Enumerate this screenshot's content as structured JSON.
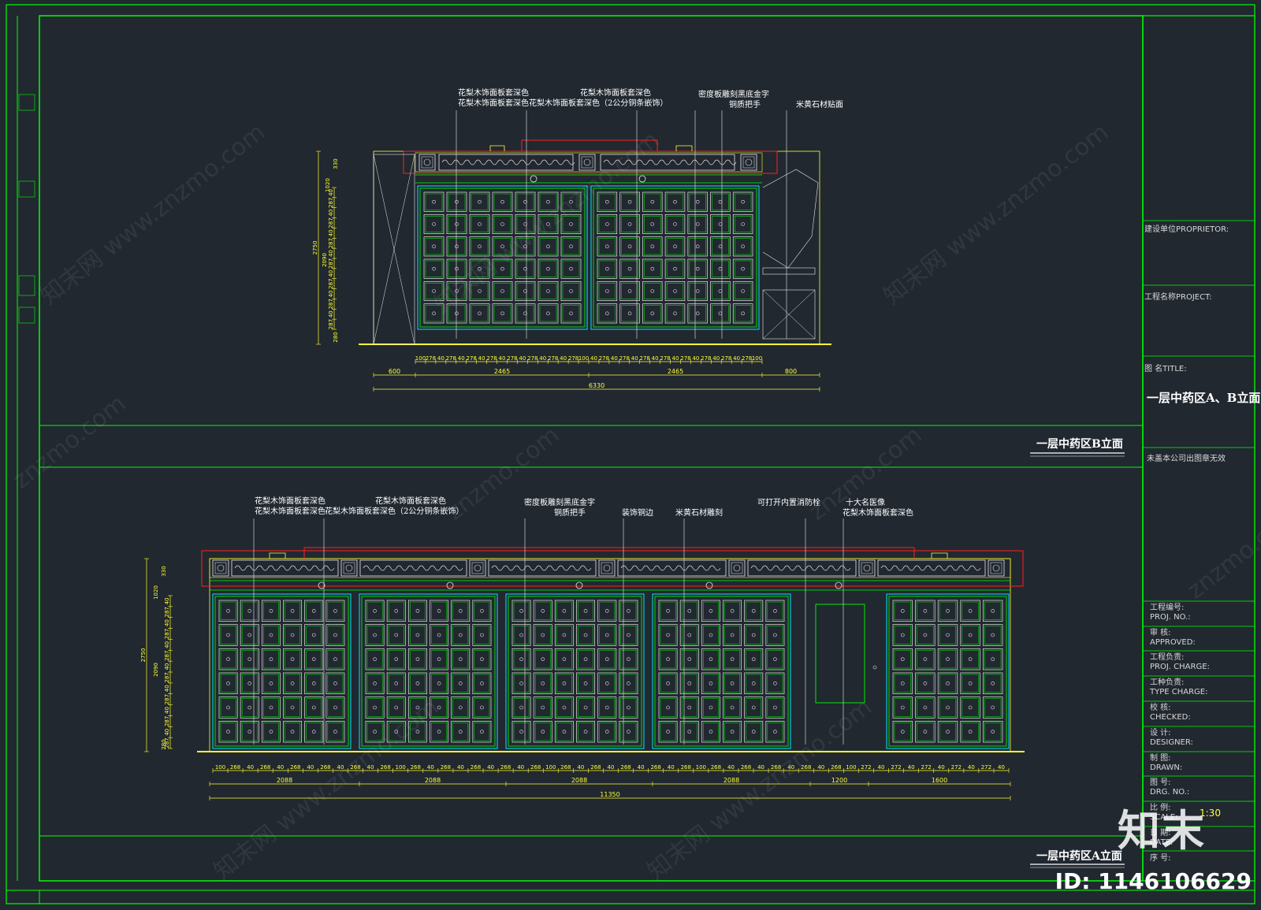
{
  "colors": {
    "background": "#212830",
    "frame": "#00ff00",
    "panel": "#00ff00",
    "drawer": "#e8e8e8",
    "cabinet_edge": "#00e5ff",
    "outline": "#ffff33",
    "highlight": "#ff2020",
    "annotation": "#ffffff",
    "dimension": "#ffff33"
  },
  "title_block": {
    "proprietor_label": "建设单位PROPRIETOR:",
    "project_label": "工程名称PROJECT:",
    "title_label": "图  名TITLE:",
    "title_value": "一层中药区A、B立面",
    "stamp_note": "未盖本公司出图章无效",
    "proj_no_label": "工程编号:",
    "proj_no_label_en": "PROJ. NO.:",
    "approved_label": "审  核:",
    "approved_label_en": "APPROVED:",
    "proj_charge_label": "工程负责:",
    "proj_charge_label_en": "PROJ. CHARGE:",
    "type_charge_label": "工种负责:",
    "type_charge_label_en": "TYPE CHARGE:",
    "checked_label": "校  核:",
    "checked_label_en": "CHECKED:",
    "designer_label": "设  计:",
    "designer_label_en": "DESIGNER:",
    "drawn_label": "制  图:",
    "drawn_label_en": "DRAWN:",
    "drg_no_label": "图  号:",
    "drg_no_label_en": "DRG. NO.:",
    "scale_label": "比  例:",
    "scale_label_en": "SCALE:",
    "scale_value": "1:30",
    "date_label": "日  期:",
    "date_label_en": "DATE:",
    "seq_label": "序  号:"
  },
  "elevation_b": {
    "title": "一层中药区B立面",
    "annotations": [
      "花梨木饰面板套深色",
      "花梨木饰面板套深色",
      "花梨木饰面板套深色",
      "花梨木饰面板套深色（2公分铜条嵌饰）",
      "密度板雕刻黑底金字",
      "铜质把手",
      "米黄石材贴面"
    ],
    "dims_bottom": {
      "row1": [
        "100",
        "278",
        "40",
        "278",
        "40",
        "278",
        "40",
        "278",
        "40",
        "278",
        "40",
        "278",
        "40",
        "278",
        "40",
        "278",
        "100",
        "40",
        "278",
        "40",
        "278",
        "40",
        "278",
        "40",
        "278",
        "40",
        "278",
        "40",
        "278",
        "40",
        "278",
        "40",
        "278",
        "100"
      ],
      "row1b": [
        "40",
        "100",
        "40",
        "100"
      ],
      "row2": [
        "600",
        "2465",
        "2465",
        "800"
      ],
      "total": "6330"
    },
    "dims_left": {
      "overall": "2750",
      "mid": "2090",
      "top_a": "1020",
      "top_b": "330",
      "row": [
        "40",
        "287",
        "40",
        "287",
        "40",
        "287",
        "40",
        "287",
        "40",
        "287",
        "40",
        "287",
        "40",
        "287"
      ],
      "bottom": "280"
    }
  },
  "elevation_a": {
    "title": "一层中药区A立面",
    "annotations": [
      "花梨木饰面板套深色",
      "花梨木饰面板套深色",
      "花梨木饰面板套深色",
      "花梨木饰面板套深色（2公分铜条嵌饰）",
      "密度板雕刻黑底金字",
      "铜质把手",
      "装饰铜边",
      "米黄石材雕刻",
      "可打开内置消防栓",
      "十大名医像",
      "花梨木饰面板套深色"
    ],
    "dims_bottom": {
      "row1": [
        "100",
        "268",
        "40",
        "268",
        "40",
        "268",
        "40",
        "268",
        "40",
        "268",
        "40",
        "268",
        "100",
        "268",
        "40",
        "268",
        "40",
        "268",
        "40",
        "268",
        "40",
        "268",
        "100",
        "268",
        "40",
        "268",
        "40",
        "268",
        "40",
        "268",
        "40",
        "268",
        "100",
        "268",
        "40",
        "268",
        "40",
        "268",
        "40",
        "268",
        "40",
        "268",
        "100",
        "272",
        "40",
        "272",
        "40",
        "272",
        "40",
        "272",
        "40",
        "272",
        "40"
      ],
      "row1b": [
        "40",
        "100",
        "40",
        "100",
        "40",
        "100",
        "40",
        "40"
      ],
      "row2": [
        "2088",
        "2088",
        "2088",
        "2088",
        "1200",
        "1600"
      ],
      "total": "11350"
    },
    "dims_left": {
      "overall": "2750",
      "mid": "2090",
      "top_a": "1020",
      "top_b": "330",
      "row": [
        "40",
        "287",
        "40",
        "287",
        "40",
        "287",
        "40",
        "287",
        "40",
        "287",
        "40",
        "287",
        "40",
        "287"
      ],
      "bottom": "280"
    }
  },
  "watermark": {
    "text": "znzmo.com",
    "text_alt": "知末网 www.znzmo.com",
    "logo": "知末",
    "id": "ID: 1146106629"
  }
}
